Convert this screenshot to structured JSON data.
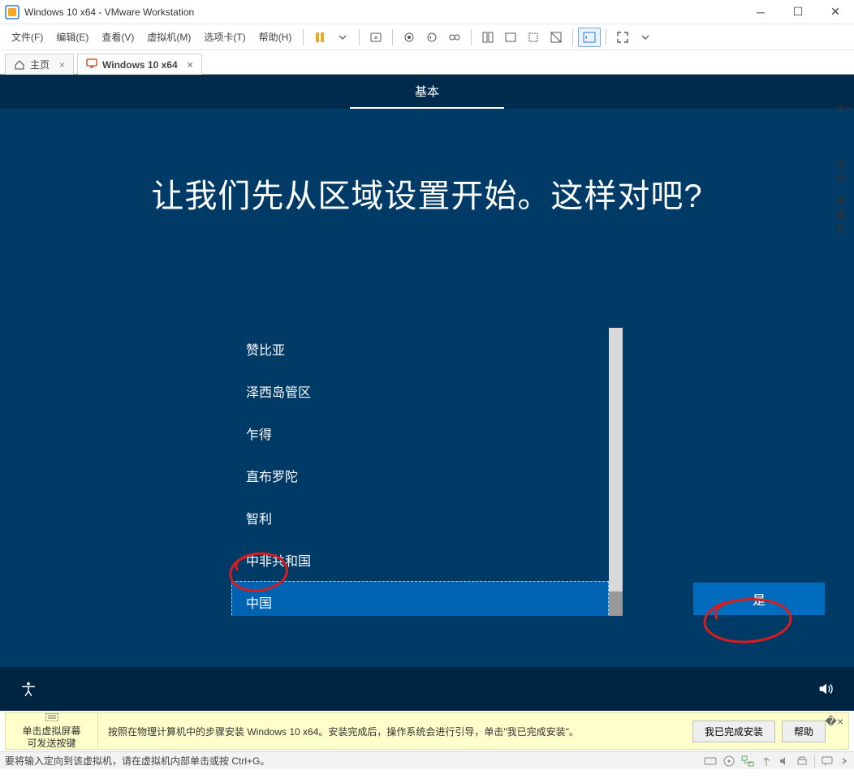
{
  "titlebar": {
    "title": "Windows 10 x64 - VMware Workstation"
  },
  "menu": {
    "file": "文件(F)",
    "edit": "编辑(E)",
    "view": "查看(V)",
    "vm": "虚拟机(M)",
    "tabs": "选项卡(T)",
    "help": "帮助(H)"
  },
  "tabs": {
    "home": "主页",
    "vm": "Windows 10 x64"
  },
  "oobe": {
    "tab_basic": "基本",
    "title": "让我们先从区域设置开始。这样对吧?",
    "regions": [
      "赞比亚",
      "泽西岛管区",
      "乍得",
      "直布罗陀",
      "智利",
      "中非共和国",
      "中国"
    ],
    "selected_index": 6,
    "yes": "是"
  },
  "infobar": {
    "left_line1": "单击虚拟屏幕",
    "left_line2": "可发送按键",
    "text": "按照在物理计算机中的步骤安装 Windows 10 x64。安装完成后，操作系统会进行引导，单击\"我已完成安装\"。",
    "btn_done": "我已完成安装",
    "btn_help": "帮助"
  },
  "statusbar": {
    "left": "要将输入定向到该虚拟机，请在虚拟机内部单击或按 Ctrl+G。"
  },
  "side": {
    "a": "dov",
    "b": "系统",
    "c": "备工",
    "d": "安装"
  }
}
